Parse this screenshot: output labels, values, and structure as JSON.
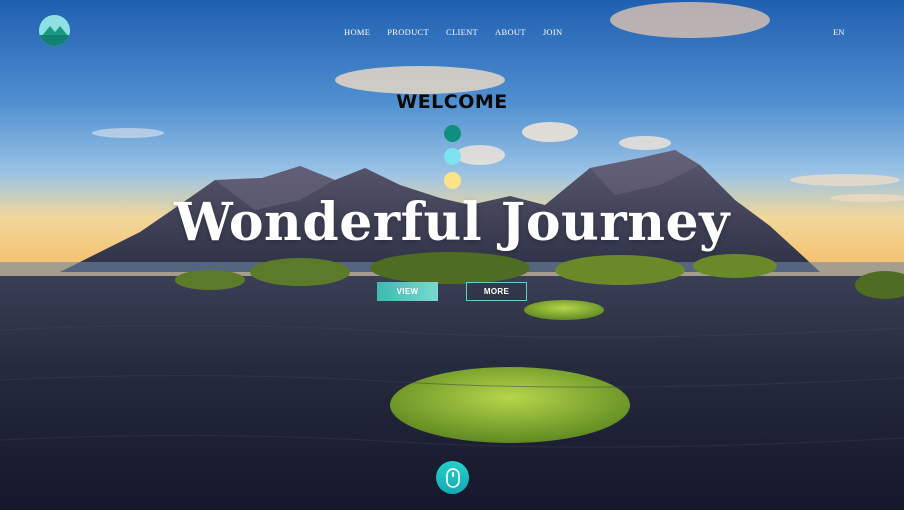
{
  "brand": {
    "logo_icon": "mountain-icon",
    "accent": "#2bb6a7"
  },
  "nav": {
    "items": [
      {
        "label": "HOME"
      },
      {
        "label": "PRODUCT"
      },
      {
        "label": "CLIENT"
      },
      {
        "label": "ABOUT"
      },
      {
        "label": "JOIN"
      }
    ],
    "lang": "EN"
  },
  "hero": {
    "welcome": "WELCOME",
    "dots": [
      "#0f8f7f",
      "#7fe3ef",
      "#fbe38a"
    ],
    "headline": "Wonderful Journey",
    "buttons": {
      "view": "VIEW",
      "more": "MORE"
    },
    "scroll_icon": "mouse-icon"
  }
}
